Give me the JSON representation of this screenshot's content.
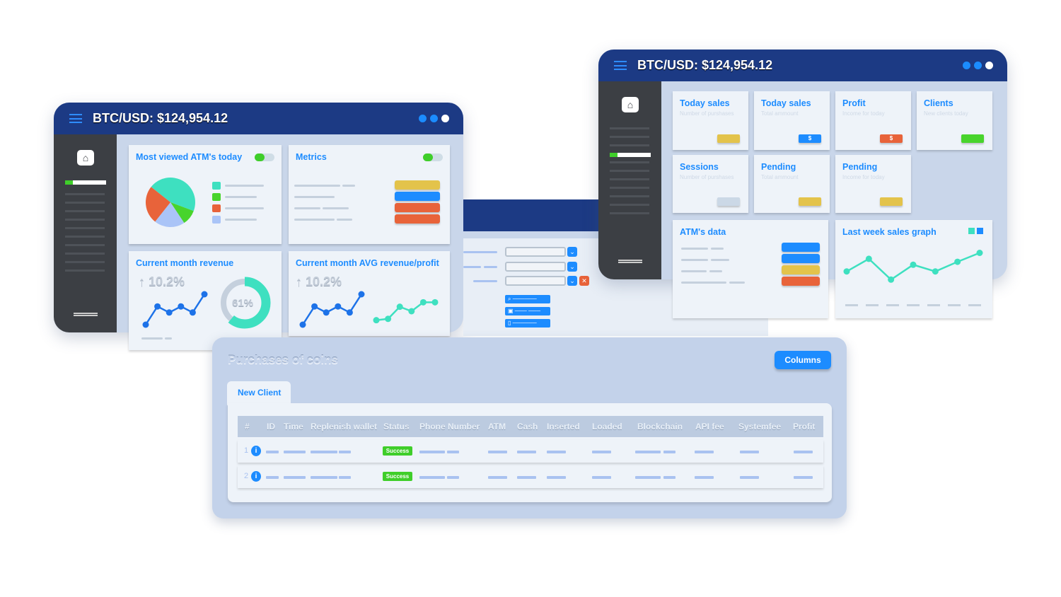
{
  "header": {
    "title": "BTC/USD: $124,954.12"
  },
  "left_window": {
    "most_viewed": {
      "title": "Most viewed ATM's today",
      "pie": [
        {
          "value": 45,
          "color": "#3ee0c0"
        },
        {
          "value": 10,
          "color": "#48d42c"
        },
        {
          "value": 20,
          "color": "#aac4f7"
        },
        {
          "value": 25,
          "color": "#e8633a"
        }
      ]
    },
    "metrics": {
      "title": "Metrics",
      "bars": [
        "#e3c34b",
        "#1d8cff",
        "#e8633a",
        "#e8633a"
      ]
    },
    "revenue": {
      "title": "Current month revenue",
      "change": "10.2%",
      "donut": "61%",
      "donut_value": 61,
      "line": [
        1,
        4,
        3,
        4,
        3,
        6
      ]
    },
    "avg": {
      "title": "Current month AVG revenue/profit",
      "change": "10.2%",
      "line_revenue": [
        1,
        4,
        3,
        4,
        3,
        6
      ],
      "line_profit": [
        1,
        1.3,
        4,
        3,
        5,
        5
      ]
    }
  },
  "right_window": {
    "stats": [
      {
        "title": "Today sales",
        "subtitle": "Number of purshases",
        "chip": "",
        "color": "#e3c34b"
      },
      {
        "title": "Today sales",
        "subtitle": "Total ammount",
        "chip": "$",
        "color": "#1d8cff"
      },
      {
        "title": "Profit",
        "subtitle": "Income for today",
        "chip": "$",
        "color": "#e8633a"
      },
      {
        "title": "Clients",
        "subtitle": "New clients today",
        "chip": "",
        "color": "#48d42c"
      },
      {
        "title": "Sessions",
        "subtitle": "Number of purshases",
        "chip": "",
        "color": "#cbd8e6"
      },
      {
        "title": "Pending",
        "subtitle": "Total ammount",
        "chip": "",
        "color": "#e3c34b"
      },
      {
        "title": "Pending",
        "subtitle": "Income for today",
        "chip": "",
        "color": "#e3c34b"
      }
    ],
    "atm_data": {
      "title": "ATM's data",
      "bars": [
        "#1d8cff",
        "#1d8cff",
        "#e3c34b",
        "#e8633a"
      ]
    },
    "sales_graph": {
      "title": "Last week sales graph",
      "values": [
        3.5,
        5.2,
        2.4,
        4.4,
        3.5,
        4.8,
        6
      ]
    }
  },
  "purchases": {
    "title": "Purchases of coins",
    "columns_button": "Columns",
    "tab": "New Client",
    "columns": [
      "#",
      "ID",
      "Time",
      "Replenish wallet",
      "Status",
      "Phone Number",
      "ATM",
      "Cash",
      "Inserted",
      "Loaded",
      "Blockchain",
      "API fee",
      "Systemfee",
      "Profit"
    ],
    "rows": [
      {
        "num": "1",
        "status": "Success"
      },
      {
        "num": "2",
        "status": "Success"
      }
    ]
  }
}
